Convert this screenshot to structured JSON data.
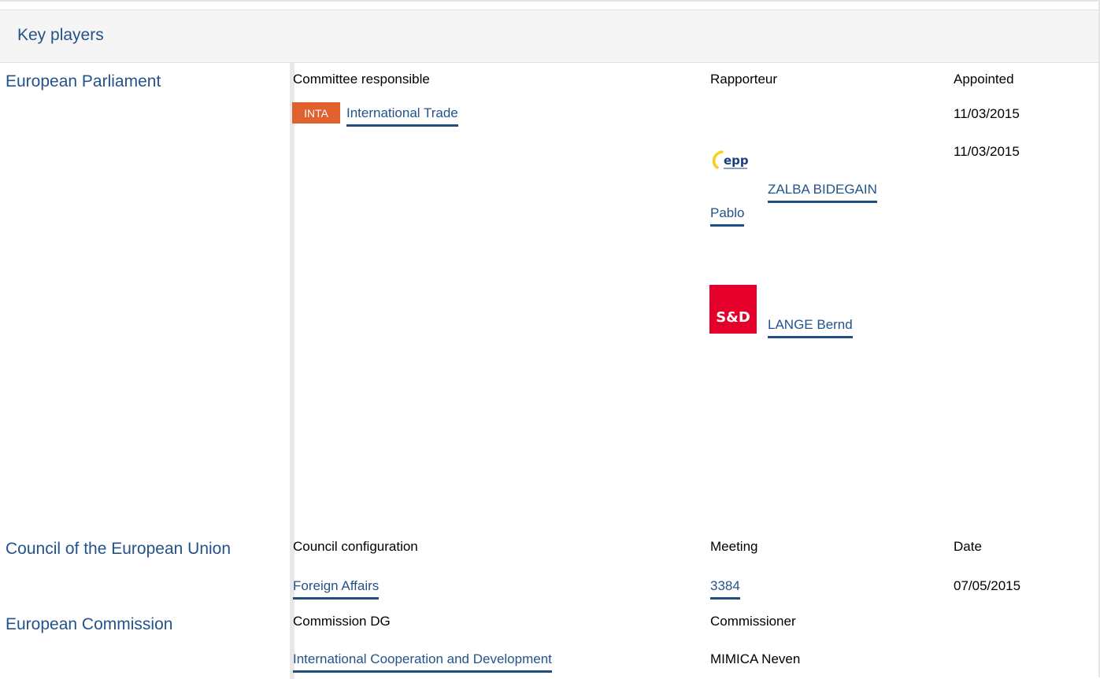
{
  "section": {
    "title": "Key players"
  },
  "european_parliament": {
    "name": "European Parliament",
    "col_committee": "Committee responsible",
    "col_rapporteur": "Rapporteur",
    "col_appointed": "Appointed",
    "committee_badge": "INTA",
    "committee_name": "International Trade",
    "committee_appointed": "11/03/2015",
    "rapporteurs": [
      {
        "group_logo": "epp-logo",
        "group_logo_text": "epp",
        "name_line1": "ZALBA BIDEGAIN",
        "name_line2": "Pablo",
        "appointed": "11/03/2015"
      },
      {
        "group_logo": "s-and-d-logo",
        "group_logo_text": "S&D",
        "name": "LANGE Bernd"
      }
    ]
  },
  "council": {
    "name": "Council of the European Union",
    "col_configuration": "Council configuration",
    "col_meeting": "Meeting",
    "col_date": "Date",
    "configuration": "Foreign Affairs",
    "meeting": "3384",
    "date": "07/05/2015"
  },
  "commission": {
    "name": "European Commission",
    "col_dg": "Commission DG",
    "col_commissioner": "Commissioner",
    "dg": "International Cooperation and Development",
    "commissioner": "MIMICA Neven"
  },
  "colors": {
    "link": "#23538a",
    "link_underline": "#1f4f82",
    "badge_bg": "#e0612d",
    "header_bg": "#f5f5f5",
    "sd_red": "#e4002b",
    "epp_blue": "#1a3d7c",
    "epp_yellow": "#f7d117"
  }
}
